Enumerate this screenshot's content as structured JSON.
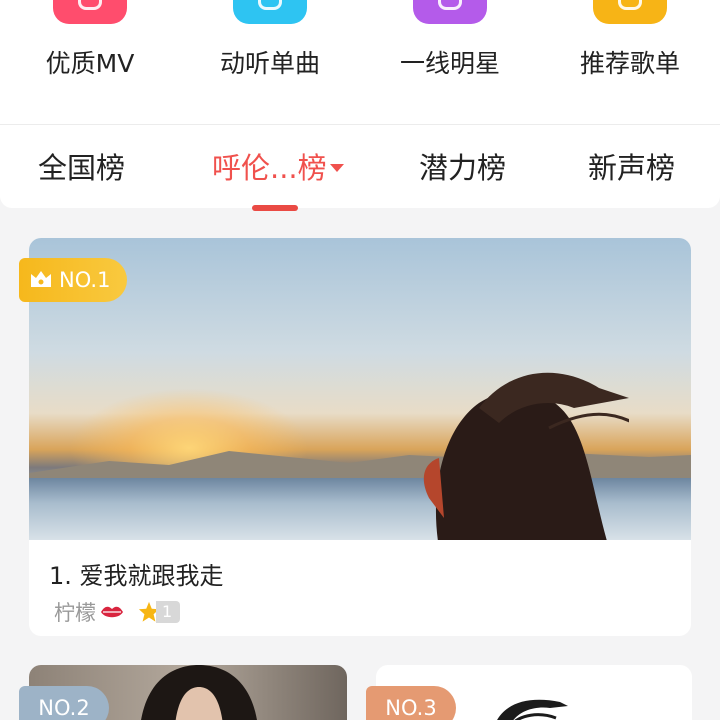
{
  "quick_entries": [
    {
      "label": "优质MV",
      "color": "#ff4d6d",
      "icon": "mv-icon"
    },
    {
      "label": "动听单曲",
      "color": "#2ec4f2",
      "icon": "disc-icon"
    },
    {
      "label": "一线明星",
      "color": "#b45bea",
      "icon": "star-person-icon"
    },
    {
      "label": "推荐歌单",
      "color": "#f7b416",
      "icon": "playlist-icon"
    }
  ],
  "tabs": [
    {
      "label": "全国榜"
    },
    {
      "label": "呼伦...榜"
    },
    {
      "label": "潜力榜"
    },
    {
      "label": "新声榜"
    }
  ],
  "active_tab": 1,
  "ranking": {
    "top": {
      "badge": "NO.1",
      "title": "1. 爱我就跟我走",
      "artist": "柠檬",
      "star_count": "1"
    },
    "second": {
      "badge": "NO.2"
    },
    "third": {
      "badge": "NO.3"
    }
  },
  "colors": {
    "accent": "#f0514d",
    "badge_gold": "#f6b81c",
    "badge_silver": "#9db3c7",
    "badge_bronze": "#e59a72"
  }
}
